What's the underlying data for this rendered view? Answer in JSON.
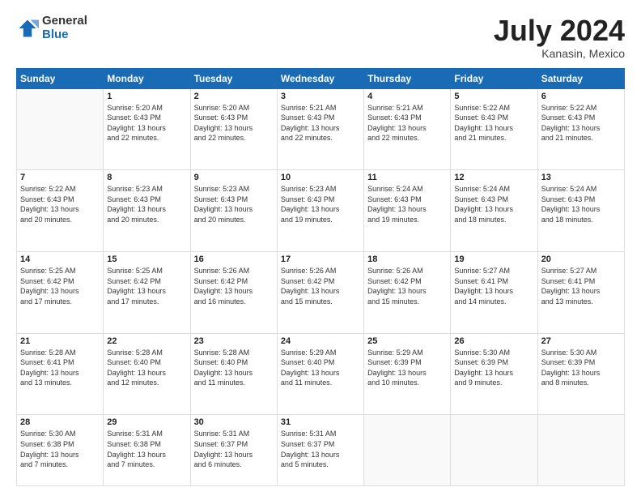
{
  "header": {
    "logo": {
      "line1": "General",
      "line2": "Blue"
    },
    "title": "July 2024",
    "location": "Kanasin, Mexico"
  },
  "weekdays": [
    "Sunday",
    "Monday",
    "Tuesday",
    "Wednesday",
    "Thursday",
    "Friday",
    "Saturday"
  ],
  "weeks": [
    [
      {
        "day": "",
        "info": ""
      },
      {
        "day": "1",
        "info": "Sunrise: 5:20 AM\nSunset: 6:43 PM\nDaylight: 13 hours\nand 22 minutes."
      },
      {
        "day": "2",
        "info": "Sunrise: 5:20 AM\nSunset: 6:43 PM\nDaylight: 13 hours\nand 22 minutes."
      },
      {
        "day": "3",
        "info": "Sunrise: 5:21 AM\nSunset: 6:43 PM\nDaylight: 13 hours\nand 22 minutes."
      },
      {
        "day": "4",
        "info": "Sunrise: 5:21 AM\nSunset: 6:43 PM\nDaylight: 13 hours\nand 22 minutes."
      },
      {
        "day": "5",
        "info": "Sunrise: 5:22 AM\nSunset: 6:43 PM\nDaylight: 13 hours\nand 21 minutes."
      },
      {
        "day": "6",
        "info": "Sunrise: 5:22 AM\nSunset: 6:43 PM\nDaylight: 13 hours\nand 21 minutes."
      }
    ],
    [
      {
        "day": "7",
        "info": "Sunrise: 5:22 AM\nSunset: 6:43 PM\nDaylight: 13 hours\nand 20 minutes."
      },
      {
        "day": "8",
        "info": "Sunrise: 5:23 AM\nSunset: 6:43 PM\nDaylight: 13 hours\nand 20 minutes."
      },
      {
        "day": "9",
        "info": "Sunrise: 5:23 AM\nSunset: 6:43 PM\nDaylight: 13 hours\nand 20 minutes."
      },
      {
        "day": "10",
        "info": "Sunrise: 5:23 AM\nSunset: 6:43 PM\nDaylight: 13 hours\nand 19 minutes."
      },
      {
        "day": "11",
        "info": "Sunrise: 5:24 AM\nSunset: 6:43 PM\nDaylight: 13 hours\nand 19 minutes."
      },
      {
        "day": "12",
        "info": "Sunrise: 5:24 AM\nSunset: 6:43 PM\nDaylight: 13 hours\nand 18 minutes."
      },
      {
        "day": "13",
        "info": "Sunrise: 5:24 AM\nSunset: 6:43 PM\nDaylight: 13 hours\nand 18 minutes."
      }
    ],
    [
      {
        "day": "14",
        "info": "Sunrise: 5:25 AM\nSunset: 6:42 PM\nDaylight: 13 hours\nand 17 minutes."
      },
      {
        "day": "15",
        "info": "Sunrise: 5:25 AM\nSunset: 6:42 PM\nDaylight: 13 hours\nand 17 minutes."
      },
      {
        "day": "16",
        "info": "Sunrise: 5:26 AM\nSunset: 6:42 PM\nDaylight: 13 hours\nand 16 minutes."
      },
      {
        "day": "17",
        "info": "Sunrise: 5:26 AM\nSunset: 6:42 PM\nDaylight: 13 hours\nand 15 minutes."
      },
      {
        "day": "18",
        "info": "Sunrise: 5:26 AM\nSunset: 6:42 PM\nDaylight: 13 hours\nand 15 minutes."
      },
      {
        "day": "19",
        "info": "Sunrise: 5:27 AM\nSunset: 6:41 PM\nDaylight: 13 hours\nand 14 minutes."
      },
      {
        "day": "20",
        "info": "Sunrise: 5:27 AM\nSunset: 6:41 PM\nDaylight: 13 hours\nand 13 minutes."
      }
    ],
    [
      {
        "day": "21",
        "info": "Sunrise: 5:28 AM\nSunset: 6:41 PM\nDaylight: 13 hours\nand 13 minutes."
      },
      {
        "day": "22",
        "info": "Sunrise: 5:28 AM\nSunset: 6:40 PM\nDaylight: 13 hours\nand 12 minutes."
      },
      {
        "day": "23",
        "info": "Sunrise: 5:28 AM\nSunset: 6:40 PM\nDaylight: 13 hours\nand 11 minutes."
      },
      {
        "day": "24",
        "info": "Sunrise: 5:29 AM\nSunset: 6:40 PM\nDaylight: 13 hours\nand 11 minutes."
      },
      {
        "day": "25",
        "info": "Sunrise: 5:29 AM\nSunset: 6:39 PM\nDaylight: 13 hours\nand 10 minutes."
      },
      {
        "day": "26",
        "info": "Sunrise: 5:30 AM\nSunset: 6:39 PM\nDaylight: 13 hours\nand 9 minutes."
      },
      {
        "day": "27",
        "info": "Sunrise: 5:30 AM\nSunset: 6:39 PM\nDaylight: 13 hours\nand 8 minutes."
      }
    ],
    [
      {
        "day": "28",
        "info": "Sunrise: 5:30 AM\nSunset: 6:38 PM\nDaylight: 13 hours\nand 7 minutes."
      },
      {
        "day": "29",
        "info": "Sunrise: 5:31 AM\nSunset: 6:38 PM\nDaylight: 13 hours\nand 7 minutes."
      },
      {
        "day": "30",
        "info": "Sunrise: 5:31 AM\nSunset: 6:37 PM\nDaylight: 13 hours\nand 6 minutes."
      },
      {
        "day": "31",
        "info": "Sunrise: 5:31 AM\nSunset: 6:37 PM\nDaylight: 13 hours\nand 5 minutes."
      },
      {
        "day": "",
        "info": ""
      },
      {
        "day": "",
        "info": ""
      },
      {
        "day": "",
        "info": ""
      }
    ]
  ],
  "colors": {
    "header_bg": "#1a6bb5",
    "logo_blue": "#1a6bb5"
  }
}
